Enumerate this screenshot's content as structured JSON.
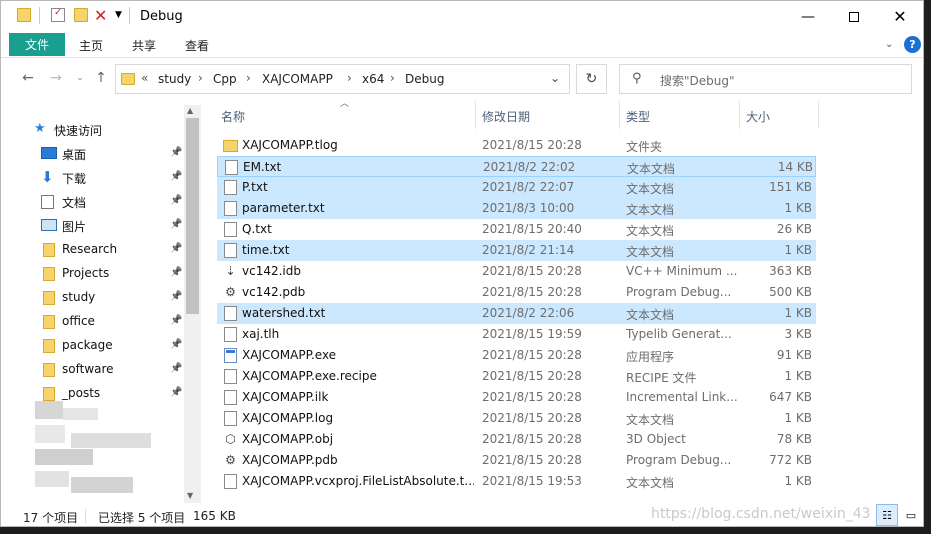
{
  "window": {
    "title": "Debug"
  },
  "ribbon": {
    "tabs": [
      "文件",
      "主页",
      "共享",
      "查看"
    ]
  },
  "address": {
    "prefix": "«",
    "crumbs": [
      "study",
      "Cpp",
      "XAJCOMAPP",
      "x64",
      "Debug"
    ]
  },
  "search": {
    "placeholder": "搜索\"Debug\""
  },
  "nav": {
    "quick_access": "快速访问",
    "items": [
      {
        "label": "桌面",
        "icon": "desktop-icon",
        "pinned": true
      },
      {
        "label": "下载",
        "icon": "download-icon",
        "pinned": true
      },
      {
        "label": "文档",
        "icon": "documents-icon",
        "pinned": true
      },
      {
        "label": "图片",
        "icon": "pictures-icon",
        "pinned": true
      },
      {
        "label": "Research",
        "icon": "folder-icon",
        "pinned": true
      },
      {
        "label": "Projects",
        "icon": "folder-icon",
        "pinned": true
      },
      {
        "label": "study",
        "icon": "folder-icon",
        "pinned": true
      },
      {
        "label": "office",
        "icon": "folder-icon",
        "pinned": true
      },
      {
        "label": "package",
        "icon": "folder-icon",
        "pinned": true
      },
      {
        "label": "software",
        "icon": "folder-icon",
        "pinned": true
      },
      {
        "label": "_posts",
        "icon": "folder-icon",
        "pinned": true
      }
    ]
  },
  "columns": {
    "name": "名称",
    "date": "修改日期",
    "type": "类型",
    "size": "大小"
  },
  "files": [
    {
      "name": "XAJCOMAPP.tlog",
      "date": "2021/8/15 20:28",
      "type": "文件夹",
      "size": "",
      "icon": "folder",
      "selected": false
    },
    {
      "name": "EM.txt",
      "date": "2021/8/2 22:02",
      "type": "文本文档",
      "size": "14 KB",
      "icon": "doc",
      "selected": true
    },
    {
      "name": "P.txt",
      "date": "2021/8/2 22:07",
      "type": "文本文档",
      "size": "151 KB",
      "icon": "doc",
      "selected": true
    },
    {
      "name": "parameter.txt",
      "date": "2021/8/3 10:00",
      "type": "文本文档",
      "size": "1 KB",
      "icon": "doc",
      "selected": true
    },
    {
      "name": "Q.txt",
      "date": "2021/8/15 20:40",
      "type": "文本文档",
      "size": "26 KB",
      "icon": "doc",
      "selected": false
    },
    {
      "name": "time.txt",
      "date": "2021/8/2 21:14",
      "type": "文本文档",
      "size": "1 KB",
      "icon": "doc",
      "selected": true
    },
    {
      "name": "vc142.idb",
      "date": "2021/8/15 20:28",
      "type": "VC++ Minimum ...",
      "size": "363 KB",
      "icon": "idb",
      "selected": false
    },
    {
      "name": "vc142.pdb",
      "date": "2021/8/15 20:28",
      "type": "Program Debug...",
      "size": "500 KB",
      "icon": "gear",
      "selected": false
    },
    {
      "name": "watershed.txt",
      "date": "2021/8/2 22:06",
      "type": "文本文档",
      "size": "1 KB",
      "icon": "doc",
      "selected": true
    },
    {
      "name": "xaj.tlh",
      "date": "2021/8/15 19:59",
      "type": "Typelib Generat...",
      "size": "3 KB",
      "icon": "doc",
      "selected": false
    },
    {
      "name": "XAJCOMAPP.exe",
      "date": "2021/8/15 20:28",
      "type": "应用程序",
      "size": "91 KB",
      "icon": "exe",
      "selected": false
    },
    {
      "name": "XAJCOMAPP.exe.recipe",
      "date": "2021/8/15 20:28",
      "type": "RECIPE 文件",
      "size": "1 KB",
      "icon": "doc",
      "selected": false
    },
    {
      "name": "XAJCOMAPP.ilk",
      "date": "2021/8/15 20:28",
      "type": "Incremental Link...",
      "size": "647 KB",
      "icon": "doc",
      "selected": false
    },
    {
      "name": "XAJCOMAPP.log",
      "date": "2021/8/15 20:28",
      "type": "文本文档",
      "size": "1 KB",
      "icon": "doc",
      "selected": false
    },
    {
      "name": "XAJCOMAPP.obj",
      "date": "2021/8/15 20:28",
      "type": "3D Object",
      "size": "78 KB",
      "icon": "obj",
      "selected": false
    },
    {
      "name": "XAJCOMAPP.pdb",
      "date": "2021/8/15 20:28",
      "type": "Program Debug...",
      "size": "772 KB",
      "icon": "gear",
      "selected": false
    },
    {
      "name": "XAJCOMAPP.vcxproj.FileListAbsolute.t...",
      "date": "2021/8/15 19:53",
      "type": "文本文档",
      "size": "1 KB",
      "icon": "doc",
      "selected": false
    }
  ],
  "status": {
    "count": "17 个项目",
    "selected": "已选择 5 个项目",
    "size": "165 KB"
  },
  "watermark": "https://blog.csdn.net/weixin_43"
}
